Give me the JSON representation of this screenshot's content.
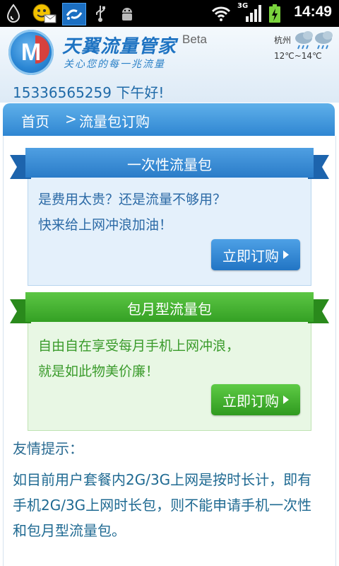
{
  "status_bar": {
    "time": "14:49",
    "network": "3G",
    "icons": [
      "drop-icon",
      "qq-face-icon",
      "mail-icon",
      "sync-icon",
      "usb-icon",
      "android-debug-icon",
      "wifi-icon",
      "signal-icon",
      "battery-charging-icon"
    ]
  },
  "header": {
    "brand": "天翼流量管家",
    "beta": "Beta",
    "slogan": "关心您的每一兆流量",
    "city": "杭州",
    "temp": "12℃~14℃",
    "greeting": "15336565259 下午好!"
  },
  "breadcrumb": {
    "home": "首页",
    "sep": ">",
    "current": "流量包订购"
  },
  "packages": [
    {
      "title": "一次性流量包",
      "line1": "是费用太贵？还是流量不够用？",
      "line2": "快来给上网冲浪加油！",
      "button": "立即订购",
      "color": "#2f86d2"
    },
    {
      "title": "包月型流量包",
      "line1": "自由自在享受每月手机上网冲浪，",
      "line2": "就是如此物美价廉！",
      "button": "立即订购",
      "color": "#3fad2a"
    }
  ],
  "tips": {
    "title": "友情提示：",
    "body": "如目前用户套餐内2G/3G上网是按时长计，即有手机2G/3G上网时长包，则不能申请手机一次性和包月型流量包。"
  }
}
